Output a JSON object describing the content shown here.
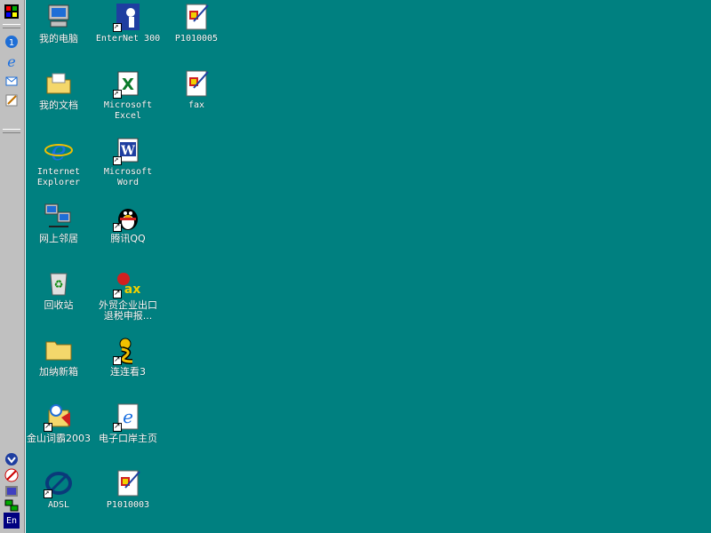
{
  "taskbar": {
    "quicklaunch": [
      {
        "name": "start-logo-icon"
      },
      {
        "name": "show-desktop-icon"
      },
      {
        "name": "ie-quicklaunch-icon"
      },
      {
        "name": "outlook-quicklaunch-icon"
      },
      {
        "name": "edit-quicklaunch-icon"
      }
    ],
    "tray": [
      {
        "name": "tray-icon-1"
      },
      {
        "name": "tray-icon-2"
      },
      {
        "name": "tray-icon-3"
      },
      {
        "name": "tray-network-icon"
      }
    ],
    "language_indicator": "En"
  },
  "desktop": {
    "icons": [
      {
        "label": "我的电脑",
        "icon": "my-computer-icon",
        "shortcut": false
      },
      {
        "label": "EnterNet 300",
        "icon": "enternet-icon",
        "shortcut": true
      },
      {
        "label": "P1010005",
        "icon": "image-file-icon",
        "shortcut": false
      },
      {
        "label": "我的文档",
        "icon": "my-documents-icon",
        "shortcut": false
      },
      {
        "label": "Microsoft\nExcel",
        "icon": "excel-icon",
        "shortcut": true
      },
      {
        "label": "fax",
        "icon": "image-file-icon",
        "shortcut": false
      },
      {
        "label": "Internet\nExplorer",
        "icon": "internet-explorer-icon",
        "shortcut": false
      },
      {
        "label": "Microsoft\nWord",
        "icon": "word-icon",
        "shortcut": true
      },
      {
        "label": "网上邻居",
        "icon": "network-neighborhood-icon",
        "shortcut": false
      },
      {
        "label": "腾讯QQ",
        "icon": "qq-icon",
        "shortcut": true
      },
      {
        "label": "回收站",
        "icon": "recycle-bin-icon",
        "shortcut": false
      },
      {
        "label": "外贸企业出口\n退税申报...",
        "icon": "tax-icon",
        "shortcut": true
      },
      {
        "label": "加纳新箱",
        "icon": "folder-icon",
        "shortcut": false
      },
      {
        "label": "连连看3",
        "icon": "game-icon",
        "shortcut": true
      },
      {
        "label": "金山词霸2003",
        "icon": "dictionary-icon",
        "shortcut": true
      },
      {
        "label": "电子口岸主页",
        "icon": "ie-page-icon",
        "shortcut": true
      },
      {
        "label": "ADSL",
        "icon": "adsl-icon",
        "shortcut": true
      },
      {
        "label": "P1010003",
        "icon": "image-file-icon",
        "shortcut": false
      }
    ]
  },
  "colors": {
    "desktop": "#008080",
    "taskbar": "#c0c0c0"
  }
}
